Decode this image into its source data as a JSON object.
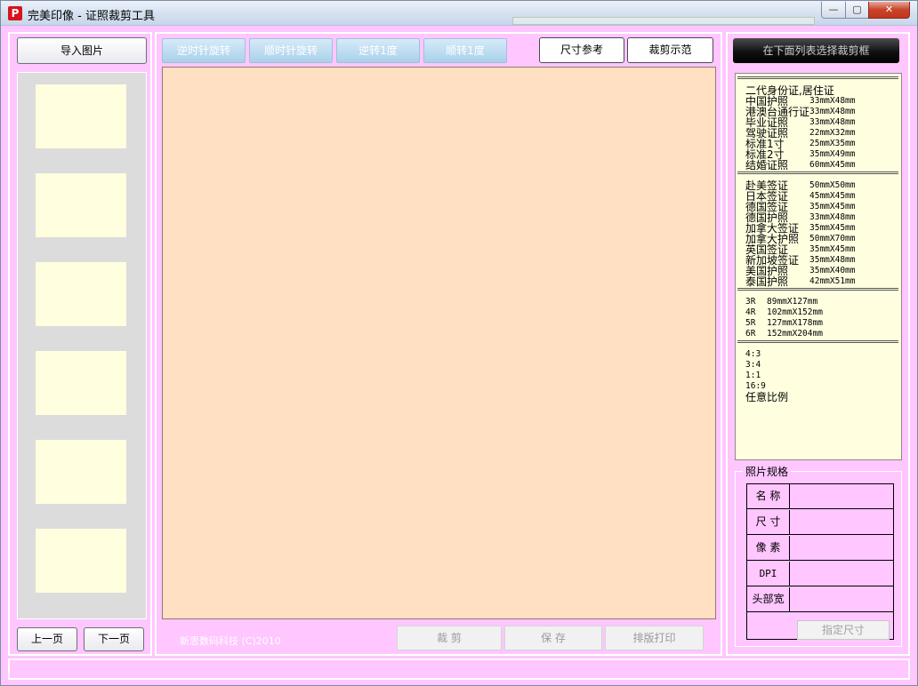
{
  "window": {
    "title": "完美印像 - 证照裁剪工具",
    "icon_letter": "P",
    "controls": {
      "minimize": "—",
      "maximize": "▢",
      "close": "✕"
    }
  },
  "left_panel": {
    "import_button": "导入图片",
    "thumbnail_count": 6,
    "prev_button": "上一页",
    "next_button": "下一页"
  },
  "toolbar": {
    "rotate_ccw_90": "逆时针旋转",
    "rotate_cw_90": "顺时针旋转",
    "rotate_ccw_1": "逆转1度",
    "rotate_cw_1": "顺转1度",
    "size_reference": "尺寸参考",
    "crop_demo": "裁剪示范"
  },
  "bottom_bar": {
    "credit": "新思数码科技 (C)2010",
    "crop_button": "裁 剪",
    "save_button": "保 存",
    "layout_print_button": "排版打印"
  },
  "right_panel": {
    "select_hint": "在下面列表选择裁剪框",
    "groups": {
      "domestic": [
        {
          "name": "二代身份证,居住证",
          "size": ""
        },
        {
          "name": "中国护照",
          "size": "33mmX48mm"
        },
        {
          "name": "港澳台通行证",
          "size": "33mmX48mm"
        },
        {
          "name": "毕业证照",
          "size": "33mmX48mm"
        },
        {
          "name": "驾驶证照",
          "size": "22mmX32mm"
        },
        {
          "name": "标准1寸",
          "size": "25mmX35mm"
        },
        {
          "name": "标准2寸",
          "size": "35mmX49mm"
        },
        {
          "name": "结婚证照",
          "size": "60mmX45mm"
        }
      ],
      "visa": [
        {
          "name": "赴美签证",
          "size": "50mmX50mm"
        },
        {
          "name": "日本签证",
          "size": "45mmX45mm"
        },
        {
          "name": "德国签证",
          "size": "35mmX45mm"
        },
        {
          "name": "德国护照",
          "size": "33mmX48mm"
        },
        {
          "name": "加拿大签证",
          "size": "35mmX45mm"
        },
        {
          "name": "加拿大护照",
          "size": "50mmX70mm"
        },
        {
          "name": "英国签证",
          "size": "35mmX45mm"
        },
        {
          "name": "新加坡签证",
          "size": "35mmX48mm"
        },
        {
          "name": "美国护照",
          "size": "35mmX40mm"
        },
        {
          "name": "泰国护照",
          "size": "42mmX51mm"
        }
      ],
      "print": [
        {
          "name": "3R",
          "size": "89mmX127mm"
        },
        {
          "name": "4R",
          "size": "102mmX152mm"
        },
        {
          "name": "5R",
          "size": "127mmX178mm"
        },
        {
          "name": "6R",
          "size": "152mmX204mm"
        }
      ],
      "ratios": [
        "4:3",
        "3:4",
        "1:1",
        "16:9",
        "任意比例"
      ]
    },
    "spec": {
      "title": "照片规格",
      "name_label": "名 称",
      "size_label": "尺 寸",
      "pixel_label": "像 素",
      "dpi_label": "DPI",
      "head_width_label": "头部宽",
      "assign_button": "指定尺寸"
    }
  }
}
